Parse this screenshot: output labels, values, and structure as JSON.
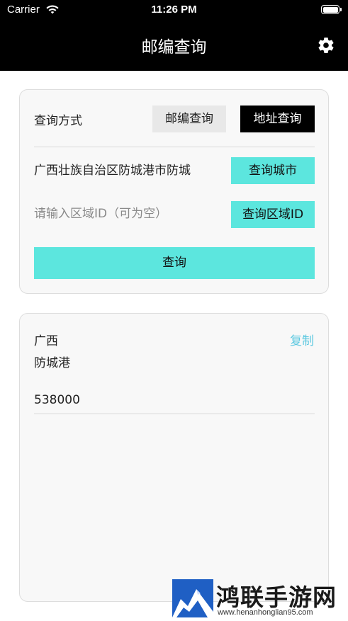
{
  "status_bar": {
    "carrier": "Carrier",
    "time": "11:26 PM"
  },
  "nav": {
    "title": "邮编查询",
    "settings_icon": "gear-icon"
  },
  "query_card": {
    "method_label": "查询方式",
    "zip_query_button": "邮编查询",
    "address_query_button": "地址查询",
    "selected_method": "地址查询",
    "city_value": "广西壮族自治区防城港市防城",
    "query_city_button": "查询城市",
    "region_placeholder": "请输入区域ID（可为空）",
    "region_value": "",
    "query_region_button": "查询区域ID",
    "submit_button": "查询"
  },
  "result_card": {
    "province": "广西",
    "city": "防城港",
    "copy_label": "复制",
    "zip_code": "538000"
  },
  "watermark": {
    "name": "鸿联手游网",
    "url": "www.henanhonglian95.com"
  },
  "colors": {
    "accent_cyan": "#5ce6de",
    "copy_link": "#5cc8e0",
    "header_bg": "#000000",
    "card_bg": "#f8f8f8"
  }
}
